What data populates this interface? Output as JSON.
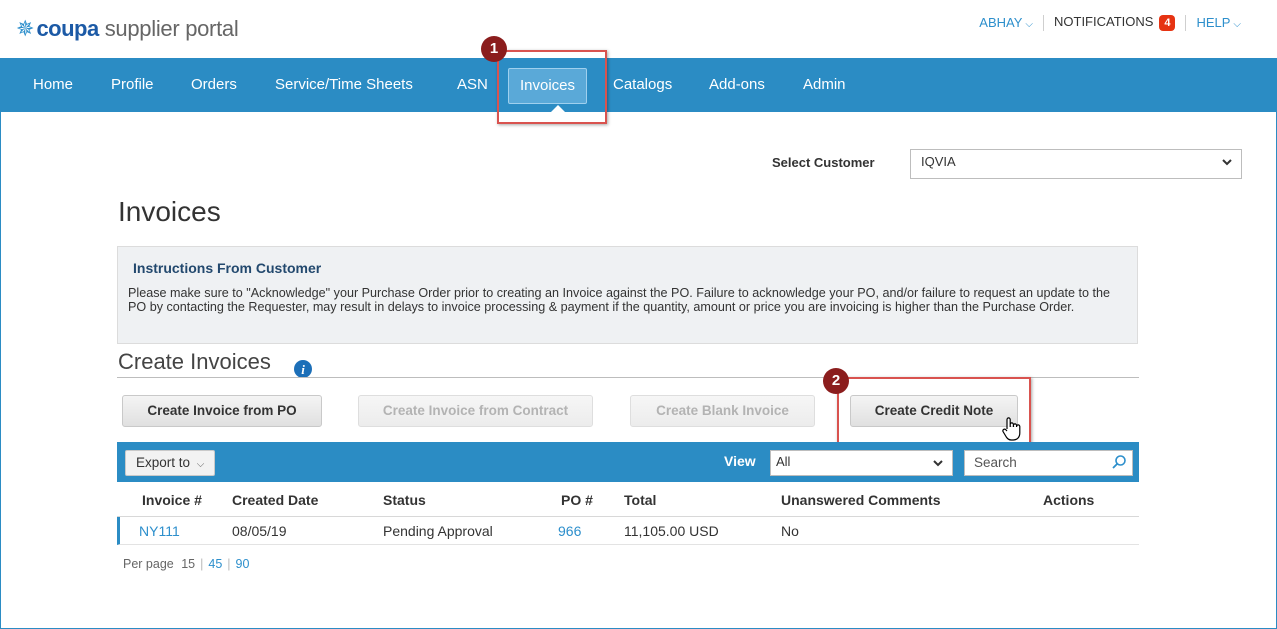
{
  "brand": {
    "logo_word": "coupa",
    "logo_tag": "supplier portal"
  },
  "utility": {
    "user": "ABHAY",
    "notifications_label": "NOTIFICATIONS",
    "notifications_count": "4",
    "help": "HELP"
  },
  "nav": {
    "items": [
      "Home",
      "Profile",
      "Orders",
      "Service/Time Sheets",
      "ASN",
      "Invoices",
      "Catalogs",
      "Add-ons",
      "Admin"
    ],
    "active": "Invoices"
  },
  "callouts": [
    "1",
    "2"
  ],
  "customer": {
    "label": "Select Customer",
    "value": "IQVIA"
  },
  "page_title": "Invoices",
  "instructions": {
    "title": "Instructions From Customer",
    "body": "Please make sure to \"Acknowledge\" your Purchase Order prior to creating an Invoice against the PO. Failure to acknowledge your PO, and/or failure to request an update to the PO by contacting the Requester, may result in delays to invoice processing & payment if the quantity, amount or price you are invoicing is higher than the Purchase Order."
  },
  "create": {
    "title": "Create Invoices",
    "buttons": {
      "from_po": "Create Invoice from PO",
      "from_contract": "Create Invoice from Contract",
      "blank": "Create Blank Invoice",
      "credit_note": "Create Credit Note"
    }
  },
  "table": {
    "export_label": "Export to",
    "view_label": "View",
    "view_value": "All",
    "search_placeholder": "Search",
    "columns": [
      "Invoice #",
      "Created Date",
      "Status",
      "PO #",
      "Total",
      "Unanswered Comments",
      "Actions"
    ],
    "rows": [
      {
        "invoice": "NY111",
        "created": "08/05/19",
        "status": "Pending Approval",
        "po": "966",
        "total": "11,105.00 USD",
        "comments": "No",
        "actions": ""
      }
    ]
  },
  "per_page": {
    "label": "Per page",
    "options": [
      "15",
      "45",
      "90"
    ]
  },
  "colors": {
    "brand_blue": "#2b8cc4",
    "badge_red": "#e63312",
    "callout_red": "#d9534f",
    "callout_fill": "#8b1d1d"
  }
}
